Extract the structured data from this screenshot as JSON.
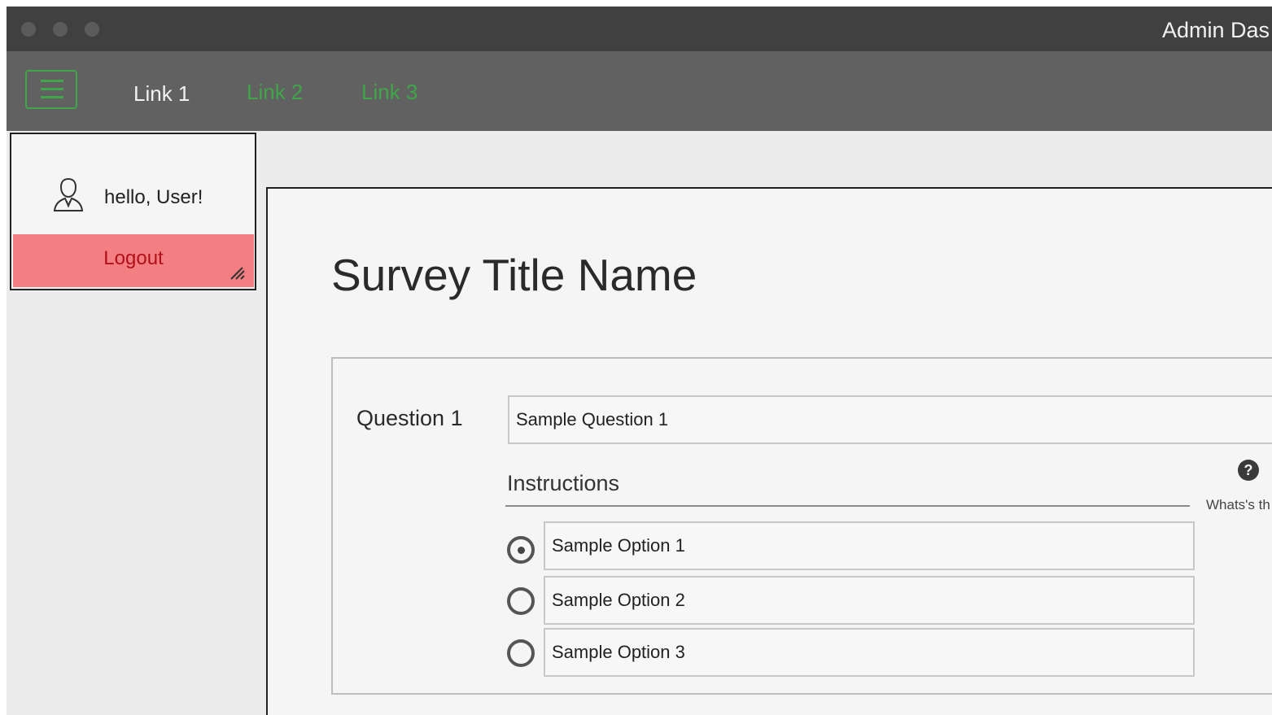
{
  "window": {
    "title": "Admin Das"
  },
  "nav": {
    "links": [
      {
        "label": "Link 1",
        "active": true
      },
      {
        "label": "Link 2",
        "active": false
      },
      {
        "label": "Link 3",
        "active": false
      }
    ]
  },
  "user_panel": {
    "greeting": "hello, User!",
    "logout_label": "Logout"
  },
  "survey": {
    "title": "Survey Title Name",
    "question_label": "Question 1",
    "question_value": "Sample Question 1",
    "instructions_label": "Instructions",
    "help_text": "Whats's th",
    "options": [
      {
        "value": "Sample Option 1",
        "selected": true
      },
      {
        "value": "Sample Option 2",
        "selected": false
      },
      {
        "value": "Sample Option 3",
        "selected": false
      }
    ]
  },
  "icons": {
    "menu": "hamburger-menu-icon",
    "user": "user-icon",
    "resize": "resize-handle-icon",
    "help": "question-circle-icon"
  },
  "colors": {
    "accent_green": "#3fa64a",
    "logout_bg": "#f47f83",
    "logout_text": "#b01018",
    "titlebar": "#404040",
    "navbar": "#616161"
  }
}
